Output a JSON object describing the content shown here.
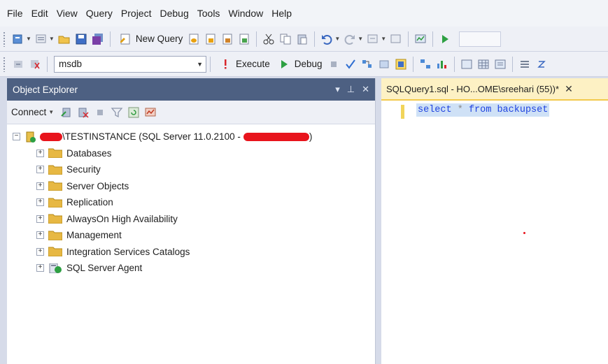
{
  "menu": [
    "File",
    "Edit",
    "View",
    "Query",
    "Project",
    "Debug",
    "Tools",
    "Window",
    "Help"
  ],
  "toolbar": {
    "new_query_label": "New Query",
    "database": "msdb",
    "execute_label": "Execute",
    "debug_label": "Debug"
  },
  "object_explorer": {
    "title": "Object Explorer",
    "pin_glyph": "▾ ⊥ ✕",
    "connect_label": "Connect",
    "server": {
      "name_visible": "\\TESTINSTANCE (SQL Server 11.0.2100 -",
      "name_tail": ")"
    },
    "nodes": [
      {
        "label": "Databases",
        "icon": "folder-icon"
      },
      {
        "label": "Security",
        "icon": "folder-icon"
      },
      {
        "label": "Server Objects",
        "icon": "folder-icon"
      },
      {
        "label": "Replication",
        "icon": "folder-icon"
      },
      {
        "label": "AlwaysOn High Availability",
        "icon": "folder-icon"
      },
      {
        "label": "Management",
        "icon": "folder-icon"
      },
      {
        "label": "Integration Services Catalogs",
        "icon": "folder-icon"
      },
      {
        "label": "SQL Server Agent",
        "icon": "sql-agent-icon"
      }
    ]
  },
  "query_editor": {
    "tab_title": "SQLQuery1.sql - HO...OME\\sreehari (55))*",
    "code": {
      "kw_select": "select",
      "star": "*",
      "kw_from": "from",
      "table": "backupset"
    }
  },
  "colors": {
    "title_bar": "#4d6082",
    "tab_active": "#fdf1c4",
    "keyword": "#1f43e0",
    "redaction": "#e8141c"
  }
}
